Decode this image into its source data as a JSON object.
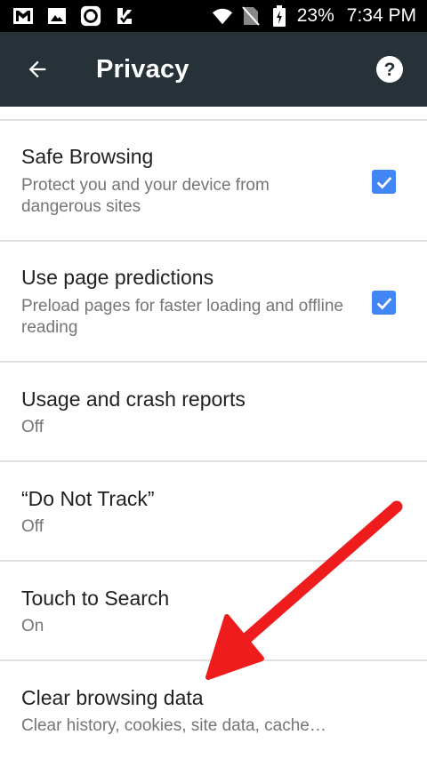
{
  "status_bar": {
    "icons_left": [
      "gmail-icon",
      "image-icon",
      "sync-app-icon",
      "delivery-icon"
    ],
    "battery_percent": "23%",
    "time": "7:34 PM"
  },
  "toolbar": {
    "title": "Privacy"
  },
  "settings": [
    {
      "title": "Safe Browsing",
      "subtitle": "Protect you and your device from dangerous sites",
      "checked": true
    },
    {
      "title": "Use page predictions",
      "subtitle": "Preload pages for faster loading and offline reading",
      "checked": true
    },
    {
      "title": "Usage and crash reports",
      "subtitle": "Off"
    },
    {
      "title": "“Do Not Track”",
      "subtitle": "Off"
    },
    {
      "title": "Touch to Search",
      "subtitle": "On"
    },
    {
      "title": "Clear browsing data",
      "subtitle": "Clear history, cookies, site data, cache…"
    }
  ],
  "colors": {
    "toolbar": "#263238",
    "checkbox": "#4285f4",
    "annotation_arrow": "#ee1c1c"
  }
}
